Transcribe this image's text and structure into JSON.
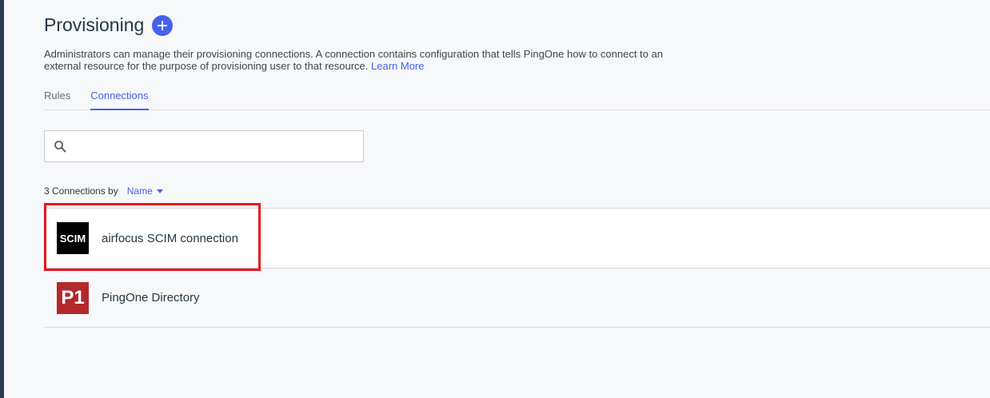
{
  "header": {
    "title": "Provisioning",
    "add_icon": "plus-icon"
  },
  "description": {
    "text": "Administrators can manage their provisioning connections. A connection contains configuration that tells PingOne how to connect to an external resource for the purpose of provisioning user to that resource.",
    "link_label": "Learn More"
  },
  "tabs": [
    {
      "label": "Rules",
      "active": false
    },
    {
      "label": "Connections",
      "active": true
    }
  ],
  "search": {
    "icon": "search-icon",
    "value": "",
    "placeholder": ""
  },
  "list": {
    "count_label": "3 Connections by",
    "sort_label": "Name"
  },
  "connections": [
    {
      "name": "airfocus SCIM connection",
      "logo_text": "SCIM",
      "logo_color": "#000000"
    },
    {
      "name": "PingOne Directory",
      "logo_text": "P1",
      "logo_color": "#b3282d"
    }
  ],
  "colors": {
    "accent": "#4462ed",
    "highlight": "#e8151b"
  }
}
